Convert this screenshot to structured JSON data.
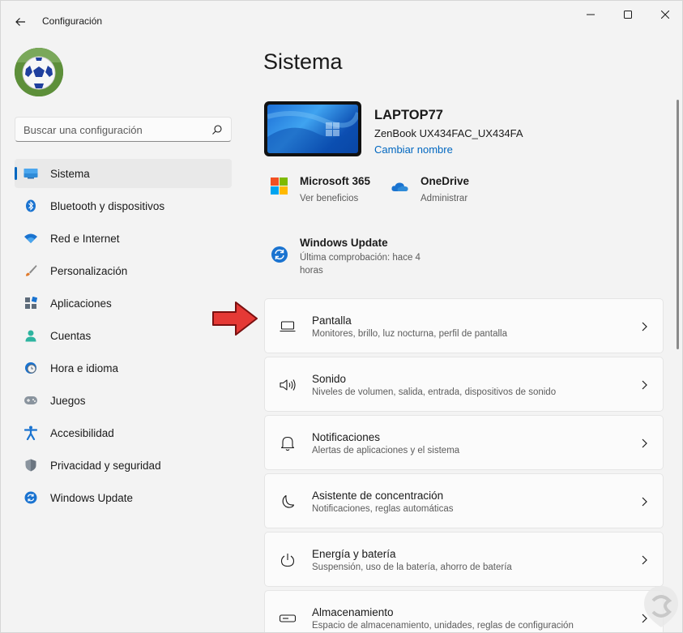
{
  "window": {
    "title": "Configuración"
  },
  "search": {
    "placeholder": "Buscar una configuración"
  },
  "sidebar": {
    "items": [
      {
        "label": "Sistema",
        "icon": "monitor-icon",
        "active": true
      },
      {
        "label": "Bluetooth y dispositivos",
        "icon": "bluetooth-icon"
      },
      {
        "label": "Red e Internet",
        "icon": "wifi-icon"
      },
      {
        "label": "Personalización",
        "icon": "brush-icon"
      },
      {
        "label": "Aplicaciones",
        "icon": "apps-icon"
      },
      {
        "label": "Cuentas",
        "icon": "person-icon"
      },
      {
        "label": "Hora e idioma",
        "icon": "globe-clock-icon"
      },
      {
        "label": "Juegos",
        "icon": "gamepad-icon"
      },
      {
        "label": "Accesibilidad",
        "icon": "accessibility-icon"
      },
      {
        "label": "Privacidad y seguridad",
        "icon": "shield-icon"
      },
      {
        "label": "Windows Update",
        "icon": "sync-icon"
      }
    ]
  },
  "main": {
    "title": "Sistema",
    "device": {
      "name": "LAPTOP77",
      "model": "ZenBook UX434FAC_UX434FA",
      "rename": "Cambiar nombre"
    },
    "tiles": {
      "m365": {
        "title": "Microsoft 365",
        "sub": "Ver beneficios"
      },
      "onedrive": {
        "title": "OneDrive",
        "sub": "Administrar"
      },
      "update": {
        "title": "Windows Update",
        "sub_line1": "Última comprobación: hace 4",
        "sub_line2": "horas"
      }
    },
    "cards": [
      {
        "title": "Pantalla",
        "sub": "Monitores, brillo, luz nocturna, perfil de pantalla",
        "icon": "display-icon"
      },
      {
        "title": "Sonido",
        "sub": "Niveles de volumen, salida, entrada, dispositivos de sonido",
        "icon": "speaker-icon"
      },
      {
        "title": "Notificaciones",
        "sub": "Alertas de aplicaciones y el sistema",
        "icon": "bell-icon"
      },
      {
        "title": "Asistente de concentración",
        "sub": "Notificaciones, reglas automáticas",
        "icon": "moon-icon"
      },
      {
        "title": "Energía y batería",
        "sub": "Suspensión, uso de la batería, ahorro de batería",
        "icon": "power-icon"
      },
      {
        "title": "Almacenamiento",
        "sub": "Espacio de almacenamiento, unidades, reglas de configuración",
        "icon": "storage-icon"
      }
    ]
  },
  "colors": {
    "accent": "#0067c0",
    "background": "#f3f3f3",
    "card": "#fbfbfb",
    "arrow": "#e53935"
  }
}
